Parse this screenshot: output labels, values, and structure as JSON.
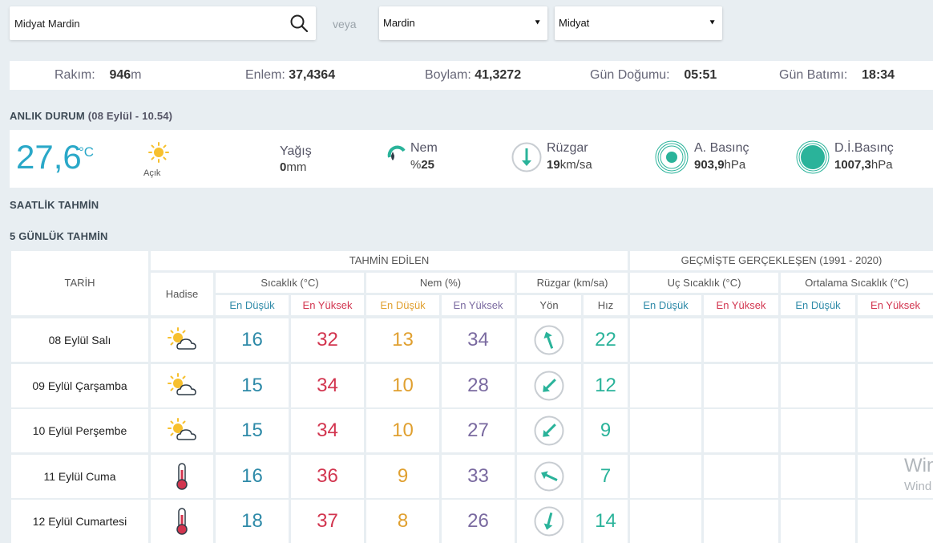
{
  "search": {
    "value": "Midyat Mardin"
  },
  "veya": "veya",
  "selects": {
    "il": "Mardin",
    "ilce": "Midyat"
  },
  "info": {
    "rakim_label": "Rakım:",
    "rakim_val": "946",
    "rakim_unit": "m",
    "enlem_label": "Enlem:",
    "enlem_val": "37,4364",
    "boylam_label": "Boylam:",
    "boylam_val": "41,3272",
    "gundogumu_label": "Gün Doğumu:",
    "gundogumu_val": "05:51",
    "gunbatimi_label": "Gün Batımı:",
    "gunbatimi_val": "18:34"
  },
  "anlik": {
    "title": "ANLIK DURUM",
    "time": "(08 Eylül - 10.54)",
    "temp": "27,6",
    "temp_unit": "°C",
    "condition": "Açık",
    "yagis_label": "Yağış",
    "yagis_val": "0",
    "yagis_unit": "mm",
    "nem_label": "Nem",
    "nem_prefix": "%",
    "nem_val": "25",
    "ruzgar_label": "Rüzgar",
    "ruzgar_val": "19",
    "ruzgar_unit": "km/sa",
    "abasinc_label": "A. Basınç",
    "abasinc_val": "903,9",
    "abasinc_unit": "hPa",
    "dbasinc_label": "D.İ.Basınç",
    "dbasinc_val": "1007,3",
    "dbasinc_unit": "hPa"
  },
  "saatlik_title": "SAATLİK TAHMİN",
  "gunluk_title": "5 GÜNLÜK TAHMİN",
  "table": {
    "tarih": "TARİH",
    "hadise": "Hadise",
    "tahmin": "TAHMİN EDİLEN",
    "gecmis": "GEÇMİŞTE GERÇEKLEŞEN (1991 - 2020)",
    "sicaklik": "Sıcaklık (°C)",
    "nem": "Nem (%)",
    "ruzgar": "Rüzgar (km/sa)",
    "uc": "Uç Sıcaklık (°C)",
    "ortalama": "Ortalama Sıcaklık (°C)",
    "en_dusuk": "En Düşük",
    "en_yuksek": "En Yüksek",
    "yon": "Yön",
    "hiz": "Hız",
    "rows": [
      {
        "date": "08 Eylül Salı",
        "icon": "sun-cloud-icon",
        "tmin": "16",
        "tmax": "32",
        "nmin": "13",
        "nmax": "34",
        "dir": 160,
        "speed": "22"
      },
      {
        "date": "09 Eylül Çarşamba",
        "icon": "sun-cloud-icon",
        "tmin": "15",
        "tmax": "34",
        "nmin": "10",
        "nmax": "28",
        "dir": 45,
        "speed": "12"
      },
      {
        "date": "10 Eylül Perşembe",
        "icon": "sun-cloud-icon",
        "tmin": "15",
        "tmax": "34",
        "nmin": "10",
        "nmax": "27",
        "dir": 45,
        "speed": "9"
      },
      {
        "date": "11 Eylül Cuma",
        "icon": "thermometer-icon",
        "tmin": "16",
        "tmax": "36",
        "nmin": "9",
        "nmax": "33",
        "dir": 115,
        "speed": "7"
      },
      {
        "date": "12 Eylül Cumartesi",
        "icon": "thermometer-icon",
        "tmin": "18",
        "tmax": "37",
        "nmin": "8",
        "nmax": "26",
        "dir": 15,
        "speed": "14"
      }
    ]
  },
  "watermark": {
    "line1": "Win",
    "line2": "Wind"
  },
  "colors": {
    "accent": "#2aa8c8",
    "low": "#2e8aa8",
    "high": "#d2354f",
    "teal": "#2ab39a"
  }
}
